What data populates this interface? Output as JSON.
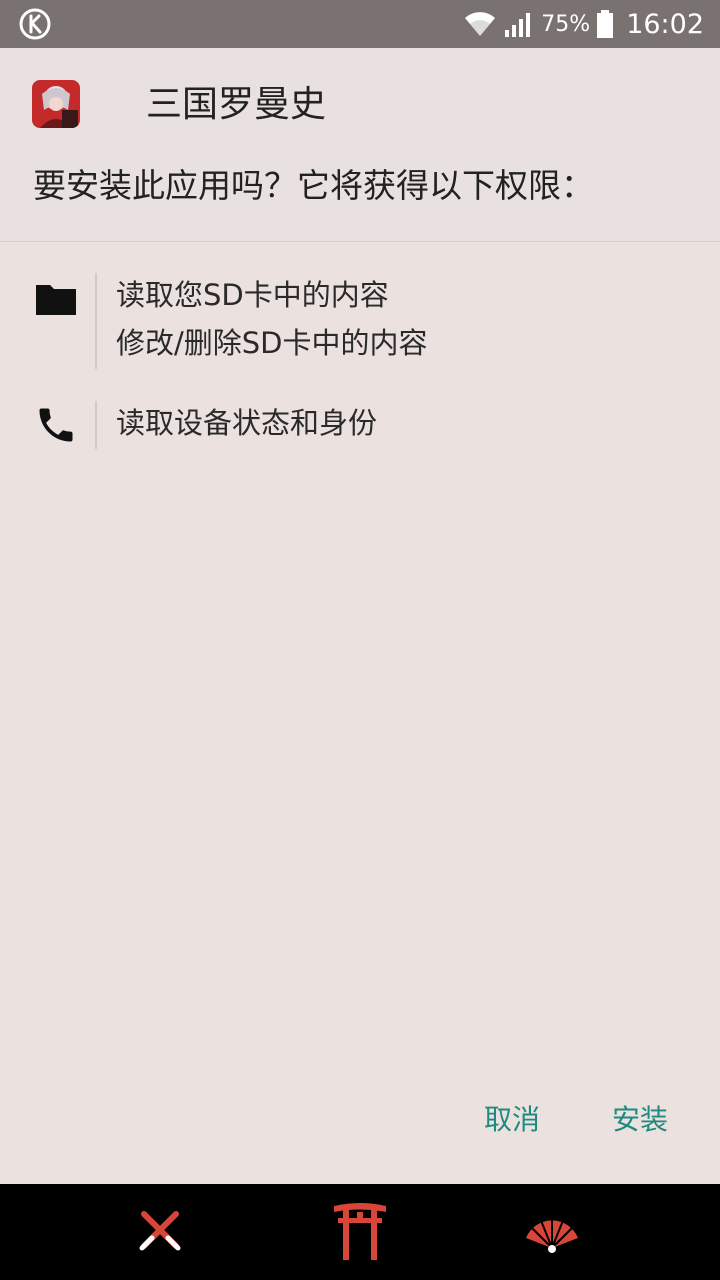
{
  "status_bar": {
    "left_icon": "k-circle-icon",
    "wifi_icon": "wifi-icon",
    "signal_icon": "cell-signal-icon",
    "battery_percent": "75%",
    "battery_icon": "battery-icon",
    "time": "16:02"
  },
  "header": {
    "app_icon": "app-icon",
    "app_name": "三国罗曼史",
    "question": "要安装此应用吗？它将获得以下权限："
  },
  "permissions": [
    {
      "icon": "folder-icon",
      "lines": [
        "读取您SD卡中的内容",
        "修改/删除SD卡中的内容"
      ]
    },
    {
      "icon": "phone-icon",
      "lines": [
        "读取设备状态和身份"
      ]
    }
  ],
  "buttons": {
    "cancel": "取消",
    "install": "安装"
  },
  "nav_bar": {
    "items": [
      "crossed-swords-icon",
      "torii-gate-icon",
      "folding-fan-icon"
    ]
  },
  "colors": {
    "accent": "#1e8a80",
    "status_bar": "#7a7270",
    "background": "#ebe2e0",
    "nav_icon": "#d8463a"
  }
}
